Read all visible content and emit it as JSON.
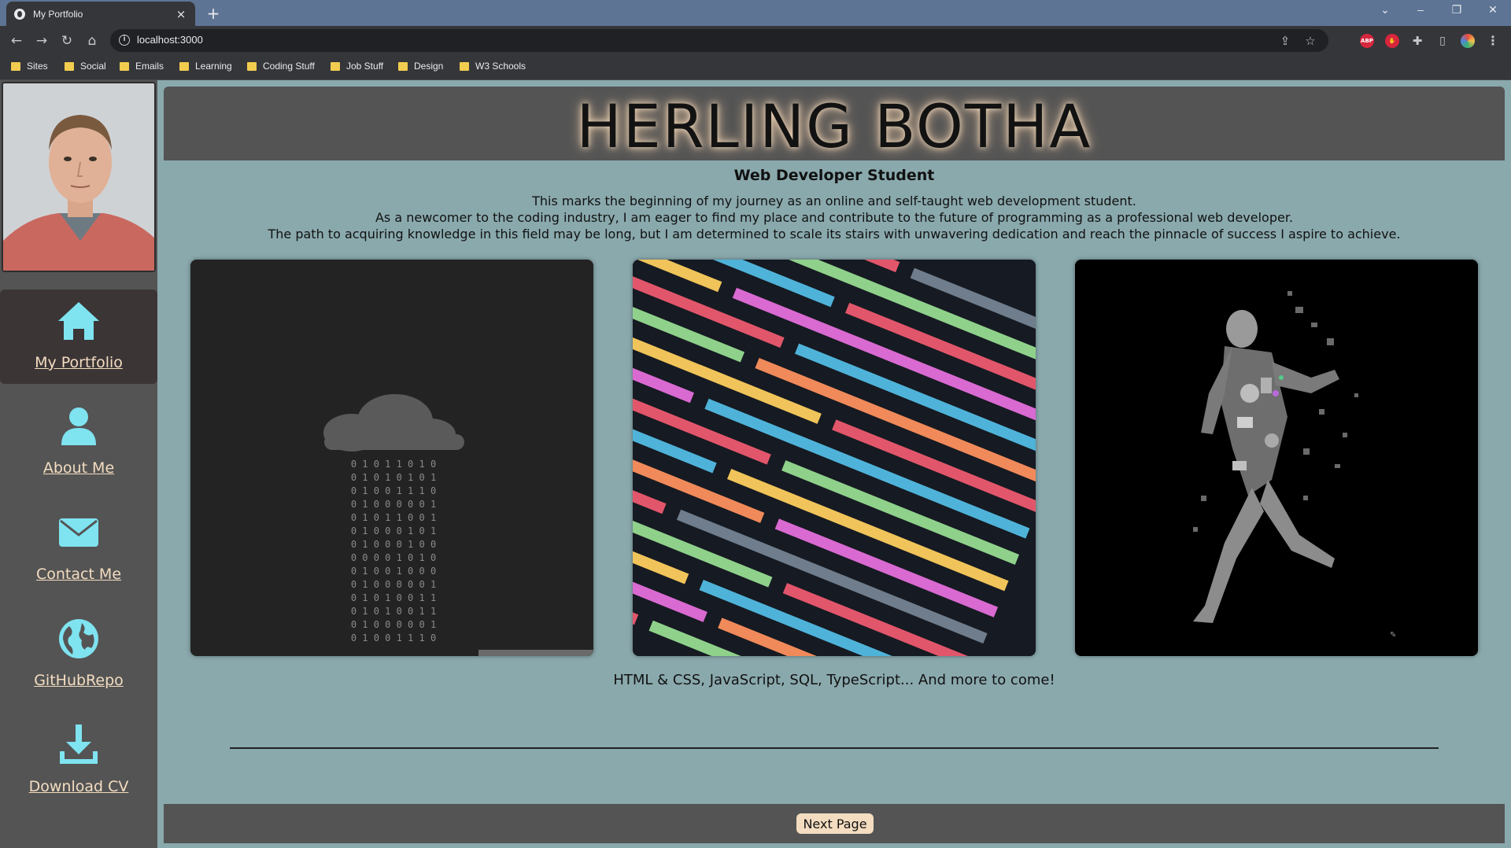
{
  "browser": {
    "tab_title": "My Portfolio",
    "tab_close": "×",
    "new_tab": "+",
    "url": "localhost:3000",
    "bookmarks": [
      "Sites",
      "Social",
      "Emails",
      "Learning",
      "Coding Stuff",
      "Job Stuff",
      "Design",
      "W3 Schools"
    ]
  },
  "sidebar": {
    "items": [
      {
        "label": "My Portfolio",
        "icon": "home-icon",
        "active": true
      },
      {
        "label": "About Me",
        "icon": "person-icon"
      },
      {
        "label": "Contact Me",
        "icon": "envelope-icon"
      },
      {
        "label": "GitHubRepo",
        "icon": "globe-icon"
      },
      {
        "label": "Download CV",
        "icon": "download-icon"
      }
    ]
  },
  "header": {
    "title": "HERLING BOTHA",
    "subtitle": "Web Developer Student"
  },
  "intro": [
    "This marks the beginning of my journey as an online and self-taught web development student.",
    "As a newcomer to the coding industry, I am eager to find my place and contribute to the future of programming as a professional web developer.",
    "The path to acquiring knowledge in this field may be long, but I am determined to scale its stairs with unwavering dedication and reach the pinnacle of success I aspire to achieve."
  ],
  "cards": [
    {
      "name": "binary-rain-cloud-image"
    },
    {
      "name": "colorful-code-image"
    },
    {
      "name": "tech-collage-runner-image"
    }
  ],
  "skills_text": "HTML & CSS, JavaScript, SQL, TypeScript... And more to come!",
  "footer": {
    "next_label": "Next Page"
  },
  "colors": {
    "page_bg": "#8aa9ad",
    "panel": "#545454",
    "accent": "#f3dcc0",
    "icon": "#7fe3f0"
  }
}
